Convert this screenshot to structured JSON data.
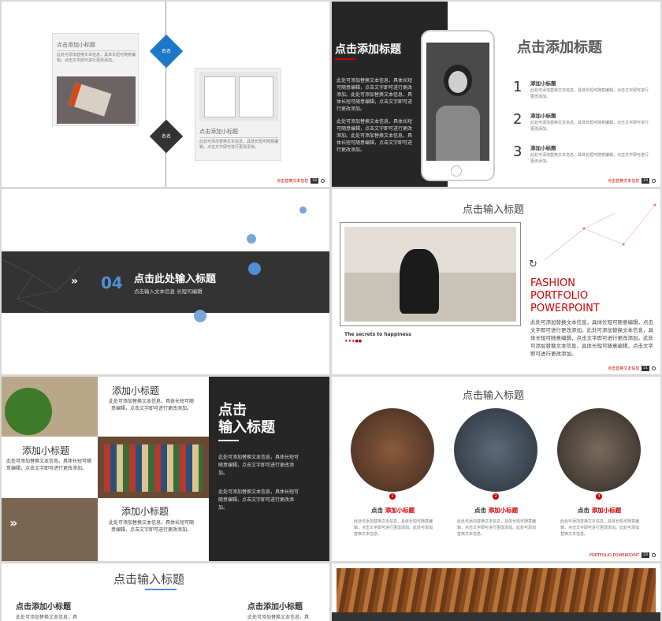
{
  "s1": {
    "card1_title": "点击添加小标题",
    "card1_text": "此处可添加替换文本信息，具体长短可随意编辑，点击文字即可进行更改添加。",
    "card2_title": "点击添加小标题",
    "card2_text": "此处可添加替换文本信息，具体长短可随意编辑，点击文字即可进行更改添加。",
    "diamond1": "名名",
    "diamond2": "名名",
    "footer_text": "点击替换文本信息",
    "page": "18"
  },
  "s2": {
    "title": "点击添加标题",
    "para1": "此处可添加替换文本信息，具体长短可随意编辑，点击文字即可进行更改添加。此处可添加替换文本信息，具体长短可随意编辑，点击文字即可进行更改添加。",
    "para2": "此处可添加替换文本信息，具体长短可随意编辑，点击文字即可进行更改添加。此处可添加替换文本信息，具体长短可随意编辑，点击文字即可进行更改添加。",
    "right_title": "点击添加标题",
    "items": [
      {
        "num": "1",
        "title": "添加小标题",
        "text": "此处可添加替换文本信息，具体长短可随意编辑，点击文字即可进行更改添加。"
      },
      {
        "num": "2",
        "title": "添加小标题",
        "text": "此处可添加替换文本信息，具体长短可随意编辑，点击文字即可进行更改添加。"
      },
      {
        "num": "3",
        "title": "添加小标题",
        "text": "此处可添加替换文本信息，具体长短可随意编辑，点击文字即可进行更改添加。"
      }
    ],
    "footer_text": "点击替换文本信息",
    "page": "19"
  },
  "s3": {
    "num": "04",
    "title": "点击此处输入标题",
    "subtitle": "点击输入文本信息 长短可编辑"
  },
  "s4": {
    "title": "点击输入标题",
    "caption": "The secrets to happiness",
    "brand1": "FASHION",
    "brand2": "PORTFOLIO",
    "brand3": "POWERPOINT",
    "text": "此处可添加替换文本信息，具体长短可随意编辑，点击文字即可进行更改添加。此处可添加替换文本信息，具体长短可随意编辑，点击文字即可进行更改添加。此处可添加替换文本信息，具体长短可随意编辑，点击文字即可进行更改添加。",
    "footer_text": "点击替换文本信息",
    "page": "21",
    "watermark": "元素"
  },
  "s5": {
    "sub1": "添加小标题",
    "text1": "此处可添加替换文本信息，具体长短可随意编辑，点击文字即可进行更改添加。",
    "sub2": "添加小标题",
    "text2": "此处可添加替换文本信息，具体长短可随意编辑，点击文字即可进行更改添加。",
    "sub3": "添加小标题",
    "text3": "此处可添加替换文本信息，具体长短可随意编辑，点击文字即可进行更改添加。",
    "title1": "点击",
    "title2": "输入标题",
    "para1": "此处可添加替换文本信息，具体长短可随意编辑，点击文字即可进行更改添加。",
    "para2": "此处可添加替换文本信息，具体长短可随意编辑，点击文字即可进行更改添加。"
  },
  "s6": {
    "title": "点击输入标题",
    "items": [
      {
        "num": "1",
        "label_a": "点击",
        "label_b": "添加小标题",
        "text": "此处可添加替换文本信息，具体长短可随意编辑，点击文字即可进行更改添加。此处可添加替换文本信息。"
      },
      {
        "num": "2",
        "label_a": "点击",
        "label_b": "添加小标题",
        "text": "此处可添加替换文本信息，具体长短可随意编辑，点击文字即可进行更改添加。此处可添加替换文本信息。"
      },
      {
        "num": "3",
        "label_a": "点击",
        "label_b": "添加小标题",
        "text": "此处可添加替换文本信息，具体长短可随意编辑，点击文字即可进行更改添加。此处可添加替换文本信息。"
      }
    ],
    "footer_text": "PORTFOLIO POWERPOINT",
    "page": "23",
    "watermark": "元素"
  },
  "s7": {
    "title": "点击输入标题",
    "left_sub": "点击添加小标题",
    "left_text": "此处可添加替换文本信息，具",
    "right_sub": "点击添加小标题",
    "right_text": "此处可添加替换文本信息，具",
    "watermark": "氢元素"
  }
}
